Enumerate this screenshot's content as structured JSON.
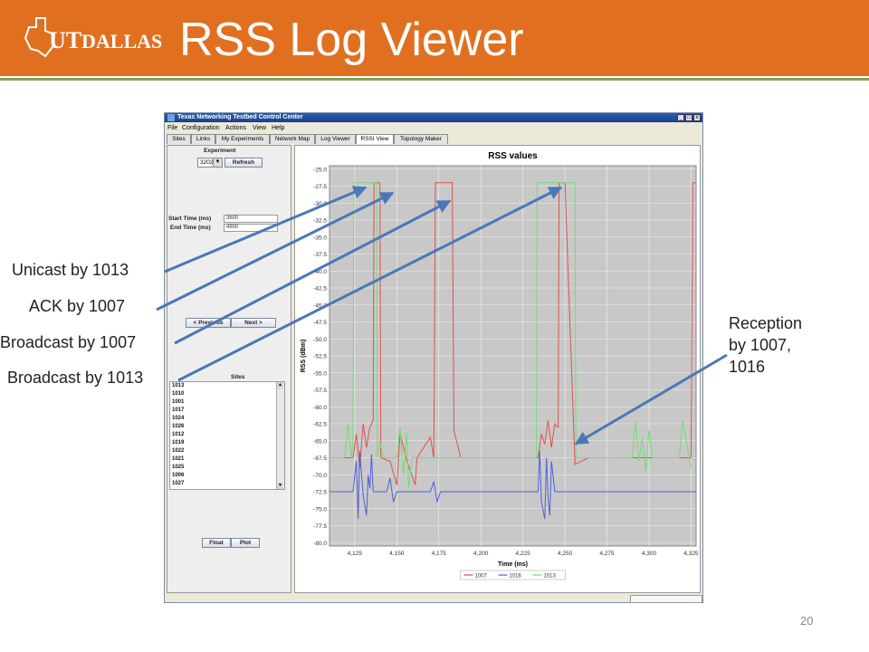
{
  "slide": {
    "title": "RSS Log Viewer",
    "logo_text": "UTDALLAS",
    "page_number": "20",
    "banner_color": "#e07020"
  },
  "window": {
    "title": "Texas Networking Testbed Control Center",
    "menus": [
      "File",
      "Configuration",
      "Actions",
      "View",
      "Help"
    ],
    "tabs": [
      "Sites",
      "Links",
      "My Experiments",
      "Network Map",
      "Log Viewer",
      "RSSI View",
      "Topology Maker"
    ],
    "active_tab": "RSSI View",
    "minimize_icon": "_",
    "maximize_icon": "□",
    "close_icon": "x"
  },
  "left_panel": {
    "experiment_label": "Experiment",
    "experiment_value": "3202",
    "dropdown_icon": "▼",
    "refresh_label": "Refresh",
    "start_time_label": "Start Time (ms)",
    "start_time_value": "3600",
    "end_time_label": "End Time (ms)",
    "end_time_value": "4800",
    "prev_label": "< Previous",
    "next_label": "Next >",
    "sites_label": "Sites",
    "sites": [
      "1013",
      "1010",
      "1001",
      "1017",
      "1024",
      "1026",
      "1012",
      "1019",
      "1022",
      "1021",
      "1025",
      "1006",
      "1027"
    ],
    "float_label": "Float",
    "plot_label": "Plot",
    "scroll_up_icon": "▲",
    "scroll_down_icon": "▼"
  },
  "chart_data": {
    "type": "line",
    "title": "RSS values",
    "xlabel": "Time (ms)",
    "ylabel": "RSS (dBm)",
    "xlim": [
      4110,
      4328
    ],
    "ylim": [
      -80.5,
      -24.5
    ],
    "x_ticks": [
      "4,125",
      "4,150",
      "4,175",
      "4,200",
      "4,225",
      "4,250",
      "4,275",
      "4,300",
      "4,325"
    ],
    "y_ticks": [
      "-25.0",
      "-27.5",
      "-30.0",
      "-32.5",
      "-35.0",
      "-37.5",
      "-40.0",
      "-42.5",
      "-45.0",
      "-47.5",
      "-50.0",
      "-52.5",
      "-55.0",
      "-57.5",
      "-60.0",
      "-62.5",
      "-65.0",
      "-67.5",
      "-70.0",
      "-72.5",
      "-75.0",
      "-77.5",
      "-80.0"
    ],
    "grid": true,
    "legend_position": "bottom",
    "series": [
      {
        "name": "1007",
        "color": "#e05050",
        "x": [
          4110,
          4124,
          4126,
          4128,
          4130,
          4132,
          4134,
          4136,
          4136.5,
          4140,
          4140.5,
          4146,
          4150,
          4152,
          4156,
          4161,
          4162,
          4170,
          4172,
          4173,
          4183,
          4184,
          4188,
          4200,
          4225,
          4234,
          4236,
          4238,
          4240,
          4242,
          4244,
          4246,
          4246.5,
          4250,
          4256,
          4264,
          4300,
          4325,
          4326,
          4328
        ],
        "y": [
          -67.5,
          -67.5,
          -64,
          -69,
          -62.5,
          -66,
          -63,
          -62,
          -27,
          -27,
          -67.5,
          -68,
          -71.5,
          -64,
          -68,
          -71.5,
          -67.5,
          -64.5,
          -67.5,
          -27,
          -27,
          -63.5,
          -67.5,
          -67.5,
          -67.5,
          -67.5,
          -64,
          -65.5,
          -62,
          -66,
          -62.5,
          -63,
          -27,
          -27,
          -68.5,
          -67.5,
          -67.5,
          -67.5,
          -27,
          -27
        ]
      },
      {
        "name": "1016",
        "color": "#5060d8",
        "x": [
          4110,
          4124,
          4126,
          4127,
          4128,
          4130,
          4132,
          4133,
          4134,
          4135,
          4136,
          4138,
          4144,
          4146,
          4148,
          4150,
          4152,
          4154,
          4170,
          4172,
          4174,
          4176,
          4180,
          4200,
          4225,
          4234,
          4235,
          4236,
          4238,
          4239,
          4240,
          4241,
          4242,
          4244,
          4246,
          4250,
          4255,
          4300,
          4328
        ],
        "y": [
          -72.5,
          -72.5,
          -68,
          -76.5,
          -66.5,
          -73,
          -76,
          -70,
          -72,
          -67,
          -72.5,
          -72.5,
          -72.5,
          -70.5,
          -74,
          -72.5,
          -72.5,
          -72.5,
          -72.5,
          -71,
          -74,
          -72.5,
          -72.5,
          -72.5,
          -72.5,
          -72.5,
          -66.5,
          -74,
          -76.5,
          -67.5,
          -73.5,
          -76,
          -68,
          -72.5,
          -72.5,
          -72.5,
          -72.5,
          -72.5,
          -72.5
        ]
      },
      {
        "name": "1013",
        "color": "#70e070",
        "x": [
          4110,
          4119,
          4121,
          4123,
          4124,
          4124.5,
          4138,
          4138.5,
          4140,
          4142,
          4150,
          4152,
          4154,
          4156,
          4157,
          4159,
          4200,
          4233,
          4233.5,
          4256,
          4256.5,
          4260,
          4290,
          4292,
          4294,
          4296,
          4298,
          4300,
          4302,
          4305,
          4318,
          4320,
          4325
        ],
        "y": [
          -67.5,
          -67.5,
          -62.5,
          -67.5,
          -65,
          -27,
          -27,
          -67.5,
          -65,
          -67.5,
          -67.5,
          -63,
          -70,
          -64,
          -72,
          -67.5,
          -67.5,
          -67.5,
          -27,
          -27,
          -67.5,
          -67.5,
          -67.5,
          -62,
          -68,
          -64.5,
          -69.5,
          -63.5,
          -67.5,
          -67.5,
          -67.5,
          -62,
          -69
        ]
      }
    ]
  },
  "annotations": {
    "unicast": "Unicast by 1013",
    "ack": "ACK by 1007",
    "broadcast_1007": "Broadcast by 1007",
    "broadcast_1013": "Broadcast by 1013",
    "reception_line1": "Reception",
    "reception_line2": "by 1007,",
    "reception_line3": "1016",
    "arrow_color": "#4a78b8"
  }
}
